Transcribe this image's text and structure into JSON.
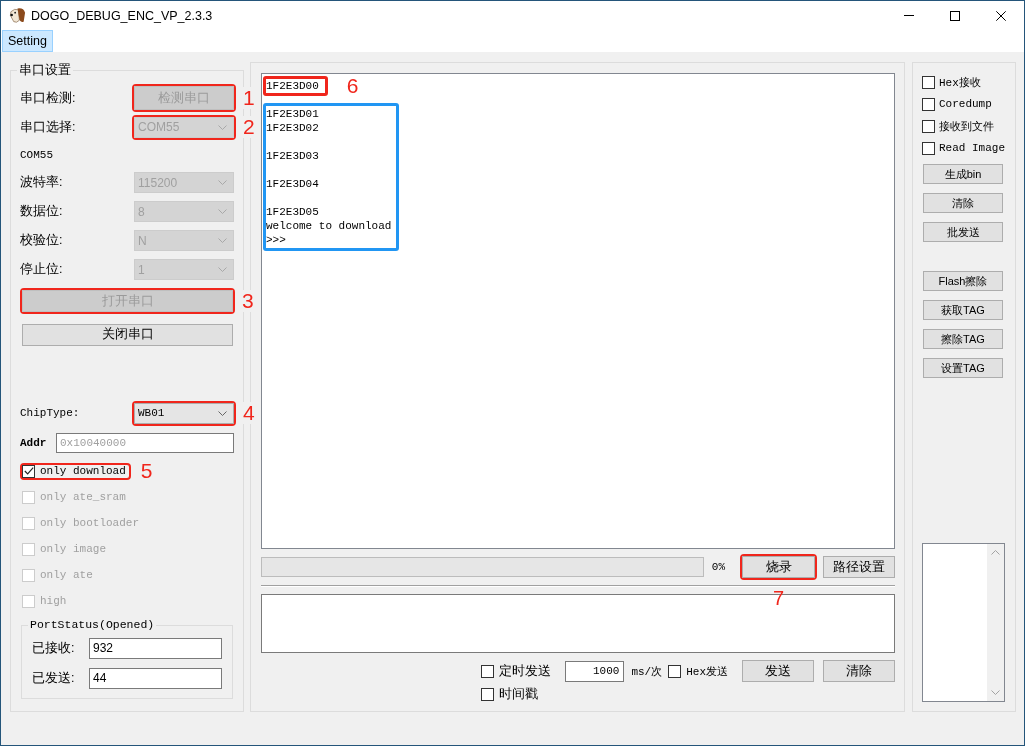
{
  "window": {
    "title": "DOGO_DEBUG_ENC_VP_2.3.3"
  },
  "menu": [
    {
      "label": "Setting",
      "selected": true
    }
  ],
  "serial_settings": {
    "title": "串口设置",
    "detect": {
      "label": "串口检测:",
      "button": "检测串口",
      "disabled": true,
      "callout": "1"
    },
    "port": {
      "label": "串口选择:",
      "value": "COM55",
      "disabled": true,
      "callout": "2"
    },
    "port_name": "COM55",
    "params": [
      {
        "label": "波特率:",
        "value": "115200",
        "disabled": true
      },
      {
        "label": "数据位:",
        "value": "8",
        "disabled": true
      },
      {
        "label": "校验位:",
        "value": "N",
        "disabled": true
      },
      {
        "label": "停止位:",
        "value": "1",
        "disabled": true
      }
    ],
    "open_button": {
      "label": "打开串口",
      "disabled": true,
      "callout": "3"
    },
    "close_button": {
      "label": "关闭串口",
      "disabled": false
    },
    "chip_type": {
      "label": "ChipType:",
      "value": "WB01",
      "disabled": false,
      "callout": "4"
    },
    "addr": {
      "label": "Addr",
      "placeholder": "0x10040000"
    },
    "options": [
      {
        "label": "only download",
        "checked": true,
        "disabled": false,
        "callout": "5"
      },
      {
        "label": "only ate_sram",
        "checked": false,
        "disabled": true
      },
      {
        "label": "only bootloader",
        "checked": false,
        "disabled": true
      },
      {
        "label": "only image",
        "checked": false,
        "disabled": true
      },
      {
        "label": "only ate",
        "checked": false,
        "disabled": true
      },
      {
        "label": "high",
        "checked": false,
        "disabled": true
      }
    ],
    "port_status": {
      "title": "PortStatus(Opened)",
      "fields": [
        {
          "label": "已接收:",
          "value": "932"
        },
        {
          "label": "已发送:",
          "value": "44"
        }
      ]
    }
  },
  "receive_log": {
    "blocks": [
      {
        "color": "#f0261c",
        "callout": "6",
        "lines": [
          {
            "kind": "text",
            "text": "1F2E3D00"
          }
        ]
      },
      {
        "color": "#2196f3",
        "lines": [
          {
            "kind": "text",
            "text": "1F2E3D01"
          },
          {
            "kind": "text",
            "text": "1F2E3D02"
          },
          {
            "kind": "blank"
          },
          {
            "kind": "text",
            "text": "1F2E3D03"
          },
          {
            "kind": "blank"
          },
          {
            "kind": "text",
            "text": "1F2E3D04"
          },
          {
            "kind": "blank"
          },
          {
            "kind": "text",
            "text": "1F2E3D05"
          },
          {
            "kind": "text",
            "text": "welcome to download"
          },
          {
            "kind": "text",
            "text": ">>>"
          }
        ]
      }
    ]
  },
  "burn": {
    "progress": {
      "level": 0,
      "reading": "0%"
    },
    "burn_button": {
      "label": "烧录",
      "callout": "7"
    },
    "path_button": {
      "label": "路径设置"
    }
  },
  "send": {
    "timed_send": {
      "label": "定时发送",
      "checked": false
    },
    "interval": "1000",
    "unit": "ms/次",
    "hex_send": {
      "label": "Hex发送",
      "checked": false
    },
    "send_button": "发送",
    "clear_button": "清除",
    "timestamp": {
      "label": "时间戳",
      "checked": false
    }
  },
  "right_panel": {
    "options": [
      {
        "label": "Hex接收",
        "checked": false
      },
      {
        "label": "Coredump",
        "checked": false
      },
      {
        "label": "接收到文件",
        "checked": false
      },
      {
        "label": "Read Image",
        "checked": false
      }
    ],
    "button_groups": [
      [
        "生成bin",
        "清除",
        "批发送"
      ],
      [
        "Flash擦除",
        "获取TAG",
        "擦除TAG",
        "设置TAG"
      ]
    ]
  }
}
